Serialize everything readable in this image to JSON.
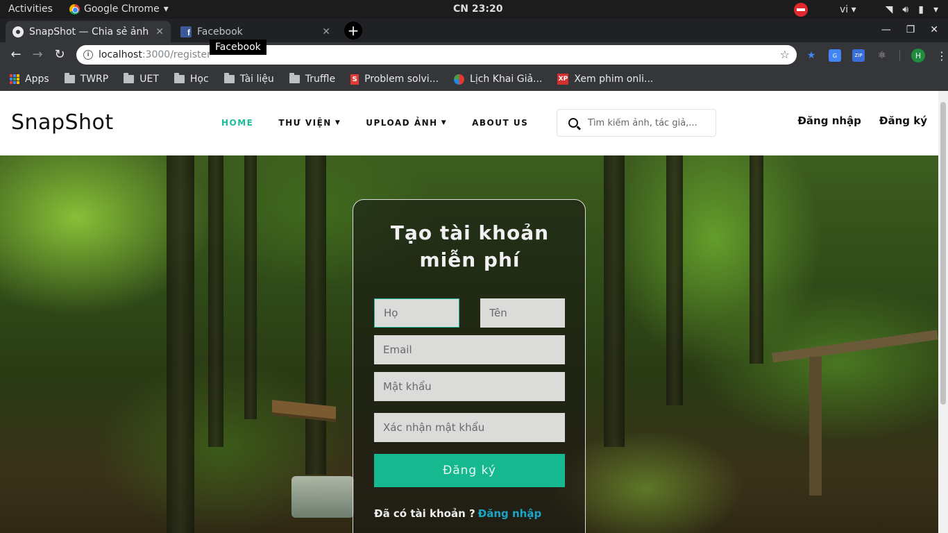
{
  "gnome": {
    "activities": "Activities",
    "app_name": "Google Chrome",
    "clock": "CN 23:20",
    "language": "vi"
  },
  "browser": {
    "tabs": [
      {
        "title": "SnapShot — Chia sẻ ảnh miễn phí",
        "favicon": "snapshot-icon"
      },
      {
        "title": "Facebook",
        "favicon": "facebook-icon"
      }
    ],
    "tooltip": "Facebook",
    "url_host": "localhost",
    "url_path": ":3000/register",
    "profile_initial": "H",
    "bookmarks": [
      "Apps",
      "TWRP",
      "UET",
      "Học",
      "Tài liệu",
      "Truffle",
      "Problem solvi...",
      "Lịch Khai Giả...",
      "Xem phim onli..."
    ]
  },
  "site": {
    "logo": "SnapShot",
    "nav": {
      "home": "HOME",
      "library": "THƯ VIỆN",
      "upload": "UPLOAD ẢNH",
      "about": "ABOUT US"
    },
    "search_placeholder": "Tìm kiếm ảnh, tác giả,...",
    "login": "Đăng nhập",
    "register": "Đăng ký",
    "accent_color": "#1abc9c"
  },
  "form": {
    "title_line1": "Tạo tài khoản",
    "title_line2": "miễn phí",
    "last_name_placeholder": "Họ",
    "first_name_placeholder": "Tên",
    "email_placeholder": "Email",
    "password_placeholder": "Mật khẩu",
    "confirm_placeholder": "Xác nhận mật khẩu",
    "submit_label": "Đăng ký",
    "have_account": "Đã có tài khoản ?",
    "login_link": "Đăng nhập"
  }
}
